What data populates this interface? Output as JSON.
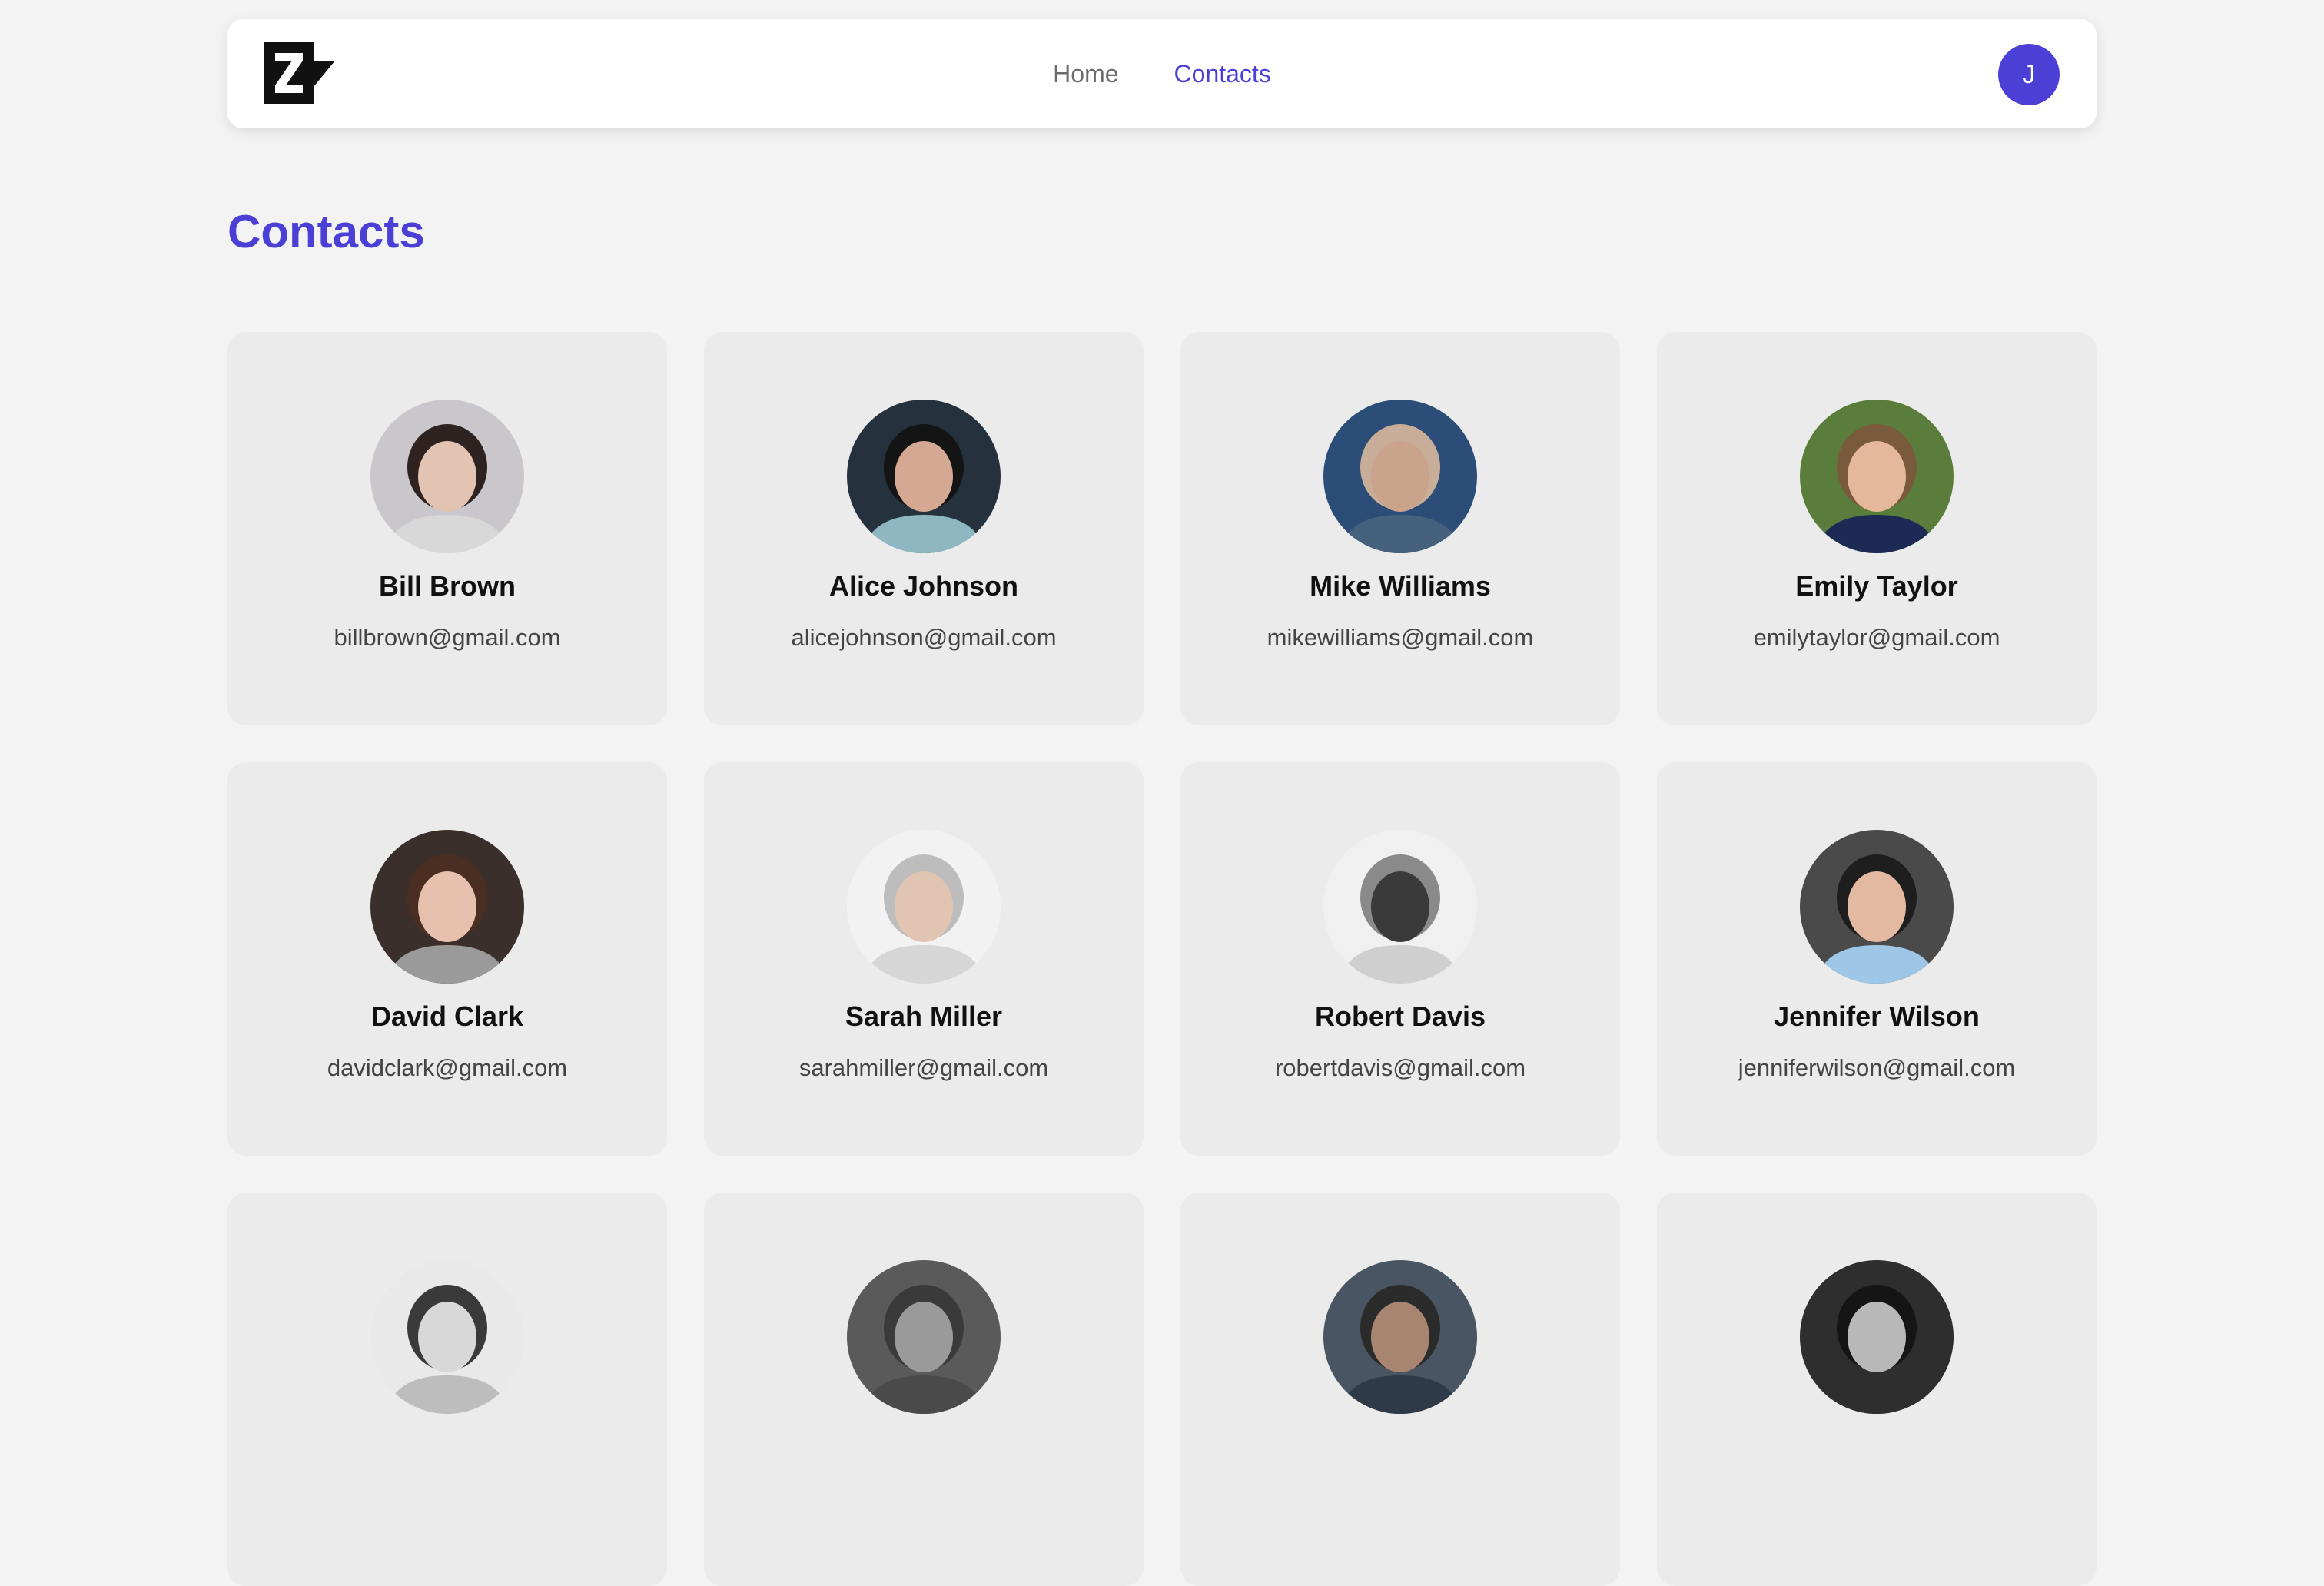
{
  "nav": {
    "logo_icon": "z-logo-icon",
    "links": [
      {
        "label": "Home",
        "active": false
      },
      {
        "label": "Contacts",
        "active": true
      }
    ],
    "avatar_initial": "J"
  },
  "page": {
    "title": "Contacts"
  },
  "colors": {
    "accent": "#4b3fd6",
    "background": "#f3f3f3",
    "card_background": "#ebebeb"
  },
  "contacts": [
    {
      "name": "Bill Brown",
      "email": "billbrown@gmail.com",
      "photo": {
        "bg": "#c9c7cc",
        "hair": "#2e2320",
        "skin": "#e3c3b2",
        "shirt": "#d8d8d8"
      }
    },
    {
      "name": "Alice Johnson",
      "email": "alicejohnson@gmail.com",
      "photo": {
        "bg": "#25313d",
        "hair": "#141414",
        "skin": "#d4a893",
        "shirt": "#8fb7c2"
      }
    },
    {
      "name": "Mike Williams",
      "email": "mikewilliams@gmail.com",
      "photo": {
        "bg": "#2c4d77",
        "hair": "#c8ad98",
        "skin": "#caa38d",
        "shirt": "#46617d"
      }
    },
    {
      "name": "Emily Taylor",
      "email": "emilytaylor@gmail.com",
      "photo": {
        "bg": "#5b7d3c",
        "hair": "#7a5a3c",
        "skin": "#e5b89b",
        "shirt": "#1c2a55"
      }
    },
    {
      "name": "David Clark",
      "email": "davidclark@gmail.com",
      "photo": {
        "bg": "#3a2f2a",
        "hair": "#4b2e22",
        "skin": "#e7c1ae",
        "shirt": "#9a9a9a"
      }
    },
    {
      "name": "Sarah Miller",
      "email": "sarahmiller@gmail.com",
      "photo": {
        "bg": "#f2f2f2",
        "hair": "#bdbdbd",
        "skin": "#e2c4b3",
        "shirt": "#d6d6d6"
      }
    },
    {
      "name": "Robert Davis",
      "email": "robertdavis@gmail.com",
      "photo": {
        "bg": "#f0f0f0",
        "hair": "#8a8a8a",
        "skin": "#3a3a3a",
        "shirt": "#cfcfcf"
      }
    },
    {
      "name": "Jennifer Wilson",
      "email": "jenniferwilson@gmail.com",
      "photo": {
        "bg": "#4a4a4a",
        "hair": "#1e1e1e",
        "skin": "#e4b9a2",
        "shirt": "#9ec6e6"
      }
    },
    {
      "name": "",
      "email": "",
      "photo": {
        "bg": "#e9e9e9",
        "hair": "#3a3a3a",
        "skin": "#d8d8d8",
        "shirt": "#bdbdbd"
      }
    },
    {
      "name": "",
      "email": "",
      "photo": {
        "bg": "#5a5a5a",
        "hair": "#3a3a3a",
        "skin": "#9a9a9a",
        "shirt": "#4a4a4a"
      }
    },
    {
      "name": "",
      "email": "",
      "photo": {
        "bg": "#4a5563",
        "hair": "#2b2b2b",
        "skin": "#a88570",
        "shirt": "#2e3a48"
      }
    },
    {
      "name": "",
      "email": "",
      "photo": {
        "bg": "#2e2e2e",
        "hair": "#151515",
        "skin": "#b8b8b8",
        "shirt": "#2e2e2e"
      }
    }
  ]
}
